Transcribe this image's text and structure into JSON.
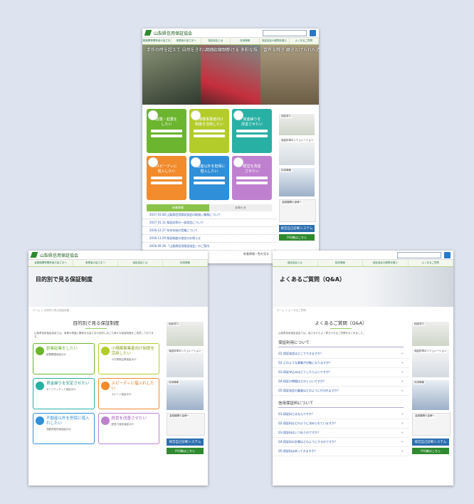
{
  "org_name": "山梨県信用保証協会",
  "nav": [
    "金融機関等関係者の皆さまへ",
    "事業者の皆さまへ",
    "保証協会とは",
    "採用情報",
    "保証協会の顧問弁護士",
    "よくあるご質問"
  ],
  "hero_captions": [
    "手作の時を超えて\n自然をきれいな紙の用紙",
    "商売と身が歩ける\n多彩な技",
    "富有る輝き\n磨きとげられた造り美"
  ],
  "cards": [
    {
      "label": "創業・起業を\nしたい",
      "color": "#6bb52f"
    },
    {
      "label": "小規模事業者向け\n制度を活用したい",
      "color": "#b3cc2a"
    },
    {
      "label": "資金繰りを\n改善させたい",
      "color": "#29b0a4"
    },
    {
      "label": "スピーディに\n借入したい",
      "color": "#f18b2c"
    },
    {
      "label": "不動産以外を担保に\n借入したい",
      "color": "#2f8fd8"
    },
    {
      "label": "経営を改善\nさせたい",
      "color": "#c080d0"
    }
  ],
  "tabs": [
    "新着情報",
    "お知らせ"
  ],
  "news": [
    "2017.03.08 山梨県信用保証協会の取扱い業務について",
    "2017.01.11 保証料率の一部改定について",
    "2016.12.27 年末年始の営業について",
    "2016.11.29 保証制度の改定のお知らせ",
    "2016.09.28 「山梨県信用保証協会」のご案内"
  ],
  "news_link": "新着情報一覧を見る",
  "sidebar": {
    "window": "相談窓口",
    "simulation": "保証料率のシミュレーション",
    "recruit": "採用情報",
    "support": "金融機関の皆様へ",
    "btn_system": "経営自己診断システム",
    "btn_faq": "FAQ集はこちら"
  },
  "page_purpose": {
    "banner": "目的別で見る保証制度",
    "title": "目的別で見る保証制度",
    "breadcrumb": "ホーム ＞ 目的別で見る保証制度",
    "intro": "山梨県信用保証協会では、事業の発展に関係ある皆さまの目的に応じた様々な保証制度をご用意しております。",
    "cards": [
      {
        "title": "創業起業をしたい",
        "sub": "創業関連保証ほか",
        "color": "#6bb52f"
      },
      {
        "title": "小規模事業者向け制度を活用したい",
        "sub": "小口零細企業保証ほか",
        "color": "#b3cc2a"
      },
      {
        "title": "資金繰りを安定させたい",
        "sub": "セーフティネット保証ほか",
        "color": "#29b0a4"
      },
      {
        "title": "スピーディに借入れしたい",
        "sub": "スピード保証ほか",
        "color": "#f18b2c"
      },
      {
        "title": "不動産以外を担保に借入れしたい",
        "sub": "流動資産担保保証ほか",
        "color": "#2f8fd8"
      },
      {
        "title": "経営を改善させたい",
        "sub": "経営力強化保証ほか",
        "color": "#c080d0"
      }
    ]
  },
  "page_faq": {
    "banner": "よくあるご質問（Q&A）",
    "title": "よくあるご質問（Q&A）",
    "breadcrumb": "ホーム ＞ よくあるご質問",
    "intro": "山梨県信用保証協会では、皆さまからよく寄せられるご質問をまとめました。",
    "section1": "保証利用について",
    "q1": [
      "Q1.保証協会はどこでできますか？",
      "Q2.どのような事業が対象になりますか？",
      "Q3.保証申込みはどうしたらよいですか？",
      "Q4.保証の期間はどのくらいですか？",
      "Q5.保証協会の審査はどのように行われますか？"
    ],
    "section2": "信用保証料について",
    "q2": [
      "Q1.保証料とはなんですか？",
      "Q2.保証料はどのように決められていますか？",
      "Q3.保証料はいつ払うのですか？",
      "Q4.保証料の計算はどのようにするのですか？",
      "Q5.保証料は戻ってきますか？"
    ]
  }
}
